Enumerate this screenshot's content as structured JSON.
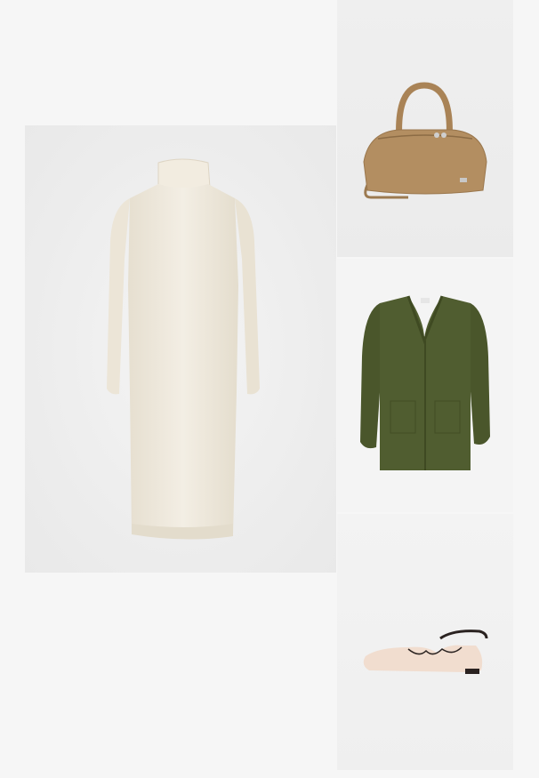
{
  "collage": {
    "items": [
      {
        "name": "turtleneck-sweater-dress",
        "color": "#efe8da"
      },
      {
        "name": "suede-handbag",
        "color": "#b28c5f"
      },
      {
        "name": "knit-cardigan",
        "color": "#4e5a2e"
      },
      {
        "name": "ankle-strap-flats",
        "color": "#f0d9c8"
      }
    ]
  }
}
